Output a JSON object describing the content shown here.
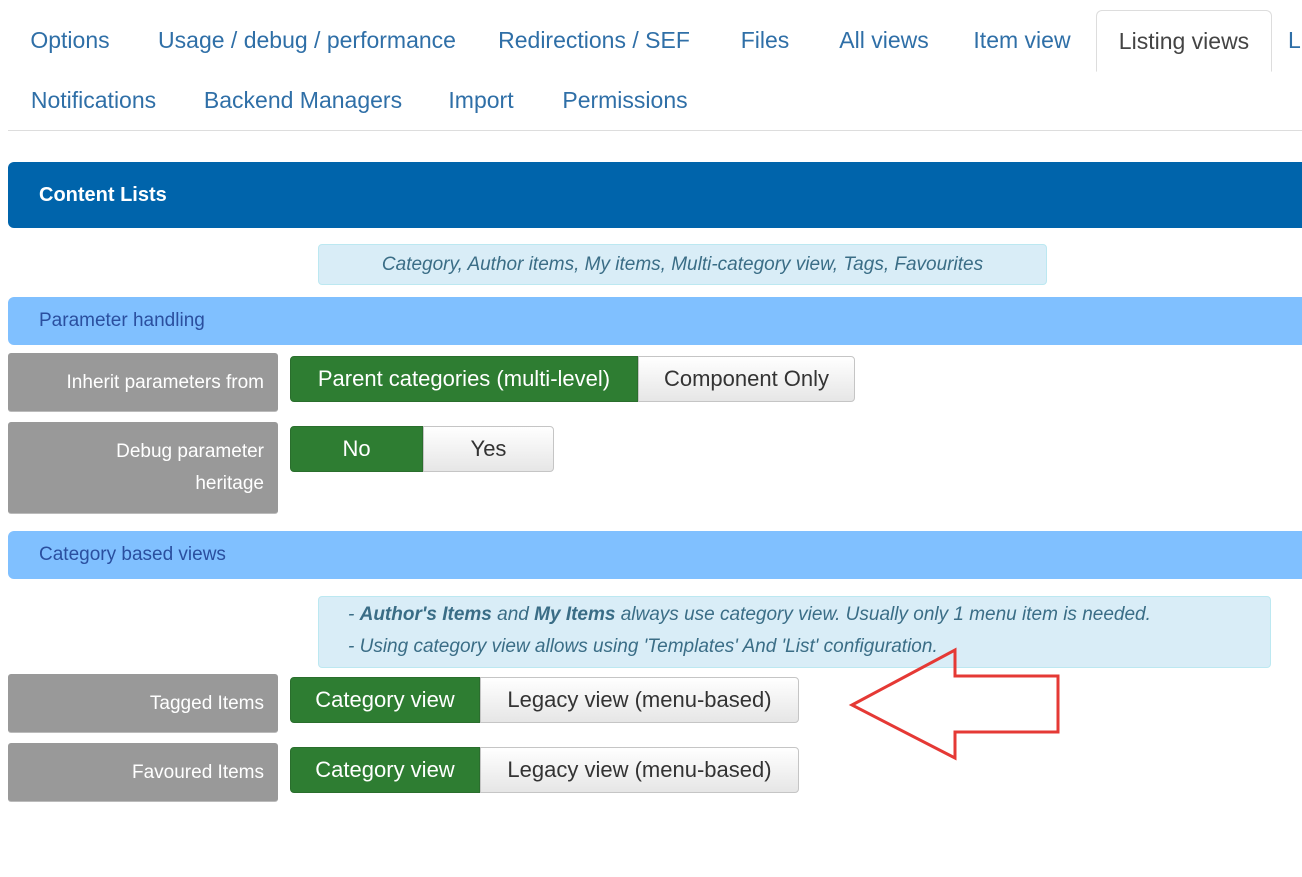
{
  "tabs": [
    {
      "label": "Options"
    },
    {
      "label": "Usage / debug / performance"
    },
    {
      "label": "Redirections / SEF"
    },
    {
      "label": "Files"
    },
    {
      "label": "All views"
    },
    {
      "label": "Item view"
    },
    {
      "label": "Listing views",
      "active": true
    },
    {
      "label": "L"
    },
    {
      "label": "Notifications"
    },
    {
      "label": "Backend Managers"
    },
    {
      "label": "Import"
    },
    {
      "label": "Permissions"
    }
  ],
  "content_header": {
    "title": "Content Lists"
  },
  "info_top": "Category, Author items, My items, Multi-category view, Tags, Favourites",
  "sections": {
    "parameter_handling": "Parameter handling",
    "category_based_views": "Category based views"
  },
  "params": {
    "inherit": {
      "label": "Inherit parameters from",
      "options": [
        "Parent categories (multi-level)",
        "Component Only"
      ],
      "selected": "Parent categories (multi-level)"
    },
    "debug": {
      "label_line1": "Debug parameter",
      "label_line2": "heritage",
      "options": [
        "No",
        "Yes"
      ],
      "selected": "No"
    },
    "tagged": {
      "label": "Tagged Items",
      "options": [
        "Category view",
        "Legacy view (menu-based)"
      ],
      "selected": "Category view"
    },
    "favoured": {
      "label": "Favoured Items",
      "options": [
        "Category view",
        "Legacy view (menu-based)"
      ],
      "selected": "Category view"
    }
  },
  "notes": {
    "line1_prefix": "- ",
    "line1_bold1": "Author's Items",
    "line1_mid": " and ",
    "line1_bold2": "My Items",
    "line1_rest": " always use category view. Usually only 1 menu item is needed.",
    "line2": "- Using category view allows using 'Templates' And 'List' configuration."
  },
  "colors": {
    "header": "#0064ab",
    "section": "#80c0ff",
    "selected_button": "#2e7d32",
    "label_bg": "#999999",
    "arrow": "#e53935"
  },
  "annotation": {
    "icon": "red-arrow-left-icon"
  }
}
